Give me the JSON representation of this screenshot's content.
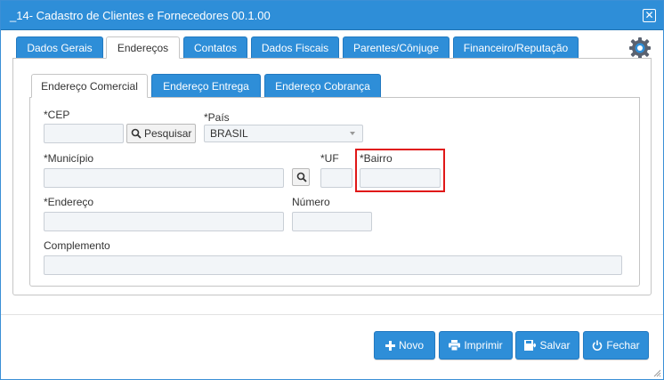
{
  "window": {
    "title": "_14- Cadastro de Clientes e Fornecedores 00.1.00",
    "close_icon": "close-icon"
  },
  "outer_tabs": [
    {
      "label": "Dados Gerais"
    },
    {
      "label": "Endereços"
    },
    {
      "label": "Contatos"
    },
    {
      "label": "Dados Fiscais"
    },
    {
      "label": "Parentes/Cônjuge"
    },
    {
      "label": "Financeiro/Reputação"
    }
  ],
  "outer_tabs_active": "Endereços",
  "inner_tabs": [
    {
      "label": "Endereço Comercial"
    },
    {
      "label": "Endereço Entrega"
    },
    {
      "label": "Endereço Cobrança"
    }
  ],
  "inner_tabs_active": "Endereço Comercial",
  "form": {
    "cep": {
      "label": "*CEP",
      "value": ""
    },
    "pesquisar_label": "Pesquisar",
    "pais": {
      "label": "*País",
      "value": "BRASIL"
    },
    "municipio": {
      "label": "*Município",
      "value": ""
    },
    "uf": {
      "label": "*UF",
      "value": ""
    },
    "bairro": {
      "label": "*Bairro",
      "value": ""
    },
    "endereco": {
      "label": "*Endereço",
      "value": ""
    },
    "numero": {
      "label": "Número",
      "value": ""
    },
    "complemento": {
      "label": "Complemento",
      "value": ""
    }
  },
  "actions": {
    "novo": "Novo",
    "imprimir": "Imprimir",
    "salvar": "Salvar",
    "fechar": "Fechar"
  },
  "colors": {
    "accent": "#2e8ed8",
    "highlight": "#e01818"
  }
}
